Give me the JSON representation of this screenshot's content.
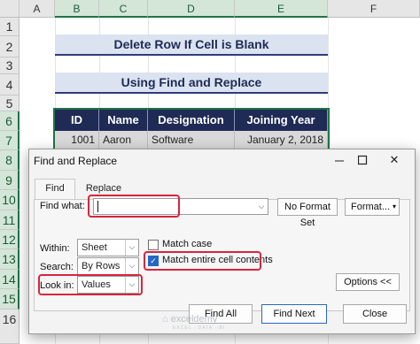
{
  "sheet": {
    "columns": [
      "A",
      "B",
      "C",
      "D",
      "E",
      "F"
    ],
    "rows": [
      "1",
      "2",
      "3",
      "4",
      "5",
      "6",
      "7",
      "8",
      "9",
      "10",
      "11",
      "12",
      "13",
      "14",
      "15",
      "16"
    ],
    "title1": "Delete Row If Cell is Blank",
    "title2": "Using Find and Replace",
    "table": {
      "headers": [
        "ID",
        "Name",
        "Designation",
        "Joining Year"
      ],
      "row1": [
        "1001",
        "Aaron",
        "Software Developer",
        "January 2, 2018"
      ]
    }
  },
  "dialog": {
    "title": "Find and Replace",
    "minimize_icon": "minimize-icon",
    "maximize_glyph": "☐",
    "close_glyph": "✕",
    "tabs": [
      "Find",
      "Replace"
    ],
    "find_what_label": "Find what:",
    "find_what_value": "",
    "format_status": "No Format Set",
    "format_button": "Format...",
    "within_label": "Within:",
    "within_value": "Sheet",
    "search_label": "Search:",
    "search_value": "By Rows",
    "lookin_label": "Look in:",
    "lookin_value": "Values",
    "match_case_label": "Match case",
    "match_case_checked": false,
    "match_entire_label": "Match entire cell contents",
    "match_entire_checked": true,
    "options_button": "Options <<",
    "find_all_button": "Find All",
    "find_next_button": "Find Next",
    "close_button": "Close"
  },
  "watermark": {
    "brand": "exceldemy",
    "tagline": "EXCEL · DATA · BI"
  },
  "colors": {
    "accent_red": "#d7263d",
    "table_header": "#1f2b55",
    "excel_green": "#217346"
  }
}
